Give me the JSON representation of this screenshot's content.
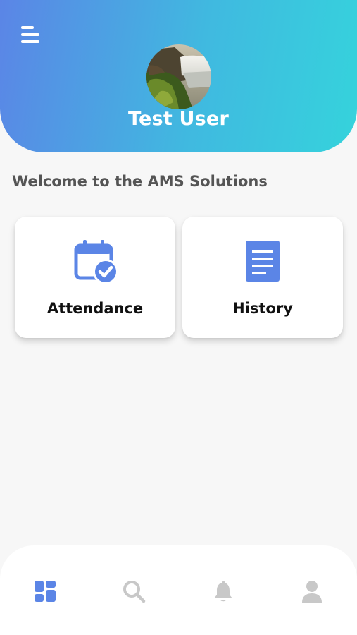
{
  "header": {
    "user_name": "Test User"
  },
  "welcome_text": "Welcome to the AMS Solutions",
  "cards": [
    {
      "label": "Attendance",
      "icon": "calendar-check-icon"
    },
    {
      "label": "History",
      "icon": "document-icon"
    }
  ],
  "bottom_nav": [
    {
      "icon": "dashboard-icon",
      "active": true
    },
    {
      "icon": "search-icon",
      "active": false
    },
    {
      "icon": "bell-icon",
      "active": false
    },
    {
      "icon": "user-icon",
      "active": false
    }
  ],
  "colors": {
    "primary": "#5b85e6",
    "gradient_start": "#5b85e6",
    "gradient_end": "#35d3dc",
    "inactive_icon": "#c8c8c8",
    "welcome_text": "#555555"
  }
}
